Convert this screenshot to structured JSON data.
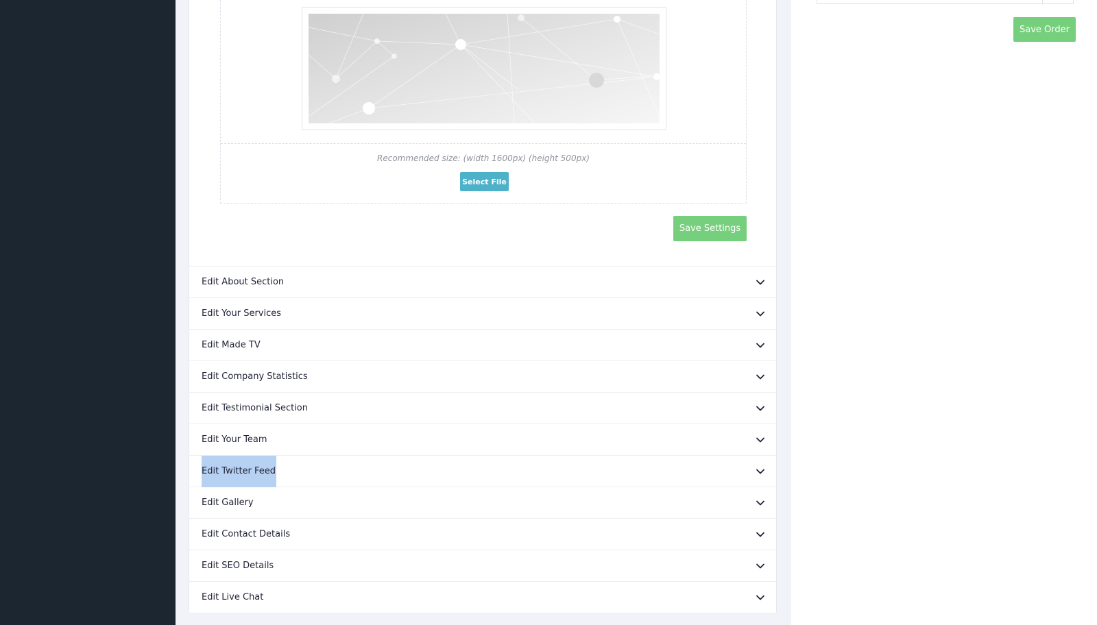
{
  "upload": {
    "recommended_size": "Recommended size: (width 1600px) (height 500px)",
    "select_file_label": "Select File"
  },
  "settings": {
    "save_label": "Save Settings"
  },
  "sections": [
    {
      "label": "Edit About Section"
    },
    {
      "label": "Edit Your Services"
    },
    {
      "label": "Edit Made TV"
    },
    {
      "label": "Edit Company Statistics"
    },
    {
      "label": "Edit Testimonial Section"
    },
    {
      "label": "Edit Your Team"
    },
    {
      "label": "Edit Twitter Feed",
      "selected": true
    },
    {
      "label": "Edit Gallery"
    },
    {
      "label": "Edit Contact Details"
    },
    {
      "label": "Edit SEO Details"
    },
    {
      "label": "Edit Live Chat"
    }
  ],
  "order": {
    "save_label": "Save Order"
  },
  "icons": {
    "section_toggle": "chevron-down-icon",
    "banner": "network-background-image"
  },
  "colors": {
    "sidebar": "#1c2630",
    "save_button": "#76cf7d",
    "select_file_button": "#4db1c9",
    "text_selection": "#b6d1f2"
  }
}
